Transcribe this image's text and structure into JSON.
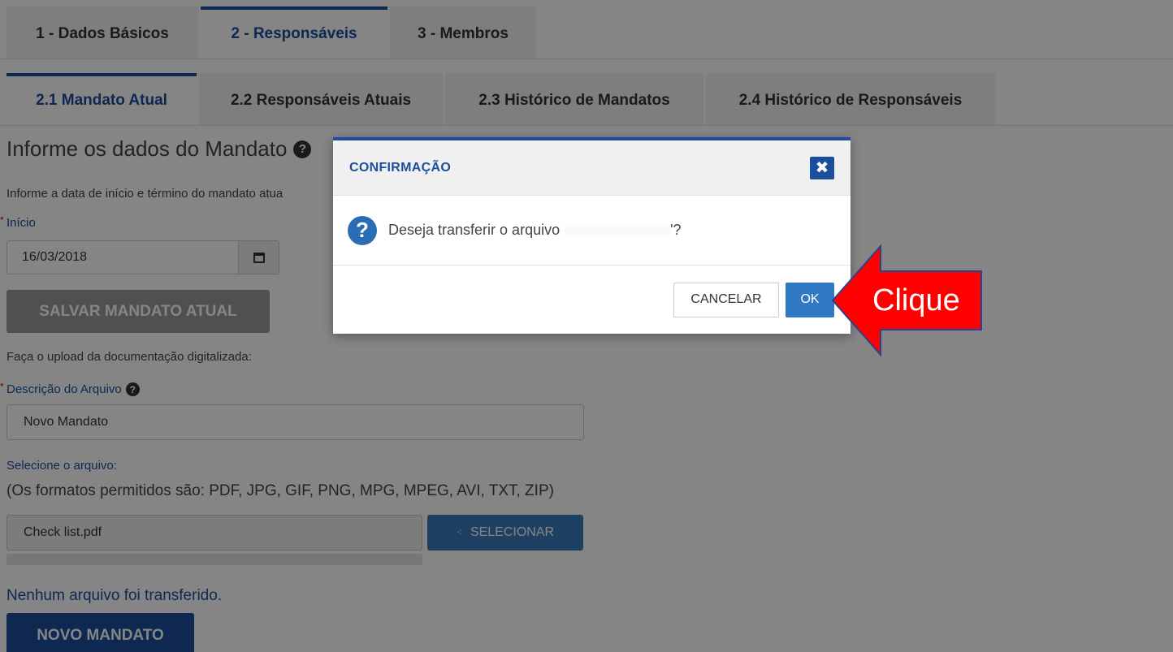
{
  "main_tabs": [
    {
      "label": "1 - Dados Básicos",
      "active": false
    },
    {
      "label": "2 - Responsáveis",
      "active": true
    },
    {
      "label": "3 - Membros",
      "active": false
    }
  ],
  "sub_tabs": [
    {
      "label": "2.1 Mandato Atual",
      "active": true
    },
    {
      "label": "2.2 Responsáveis Atuais",
      "active": false
    },
    {
      "label": "2.3 Histórico de Mandatos",
      "active": false
    },
    {
      "label": "2.4 Histórico de Responsáveis",
      "active": false
    }
  ],
  "form": {
    "section_title": "Informe os dados do Mandato",
    "info_text": "Informe a data de início e término do mandato atua",
    "start_label": "Início",
    "start_value": "16/03/2018",
    "save_button": "SALVAR MANDATO ATUAL",
    "upload_text": "Faça o upload da documentação digitalizada:",
    "description_label": "Descrição do Arquivo",
    "description_value": "Novo Mandato",
    "select_file_label": "Selecione o arquivo:",
    "formats_text": "(Os formatos permitidos são: PDF, JPG, GIF, PNG, MPG, MPEG, AVI, TXT, ZIP)",
    "file_value": "Check list.pdf",
    "select_button": "SELECIONAR",
    "no_file_text": "Nenhum arquivo foi transferido.",
    "new_mandate_button": "NOVO MANDATO"
  },
  "modal": {
    "title": "CONFIRMAÇÃO",
    "close_symbol": "✖",
    "message_prefix": "Deseja transferir o arquivo",
    "message_suffix": "'?",
    "cancel_button": "CANCELAR",
    "ok_button": "OK"
  },
  "callout": {
    "text": "Clique",
    "color": "#ff0000",
    "border_color": "#2f3f8f"
  },
  "colors": {
    "brand_blue": "#1c4e9e",
    "button_blue": "#2f78c4"
  }
}
